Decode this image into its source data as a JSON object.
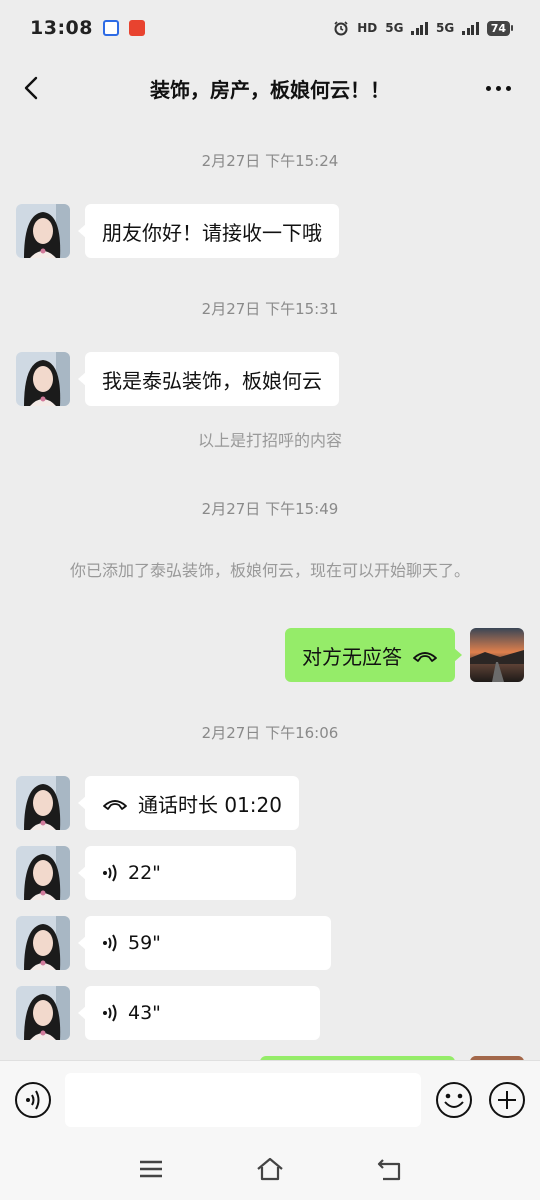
{
  "status_bar": {
    "time": "13:08",
    "hd_label": "HD",
    "sim1_label": "5G",
    "sim2_label": "5G",
    "battery": "74"
  },
  "header": {
    "title": "装饰，房产，板娘何云！！"
  },
  "messages": {
    "ts1": "2月27日 下午15:24",
    "m1": "朋友你好！请接收一下哦",
    "ts2": "2月27日 下午15:31",
    "m2": "我是泰弘装饰，板娘何云",
    "note1": "以上是打招呼的内容",
    "ts3": "2月27日 下午15:49",
    "note2": "你已添加了泰弘装饰，板娘何云，现在可以开始聊天了。",
    "m3": "对方无应答",
    "ts4": "2月27日 下午16:06",
    "m4": "通话时长 01:20",
    "v1": "22\"",
    "v2": "59\"",
    "v3": "43\""
  },
  "input_bar": {
    "placeholder": ""
  },
  "colors": {
    "background": "#ededed",
    "incoming_bubble": "#ffffff",
    "outgoing_bubble": "#95ec69"
  }
}
